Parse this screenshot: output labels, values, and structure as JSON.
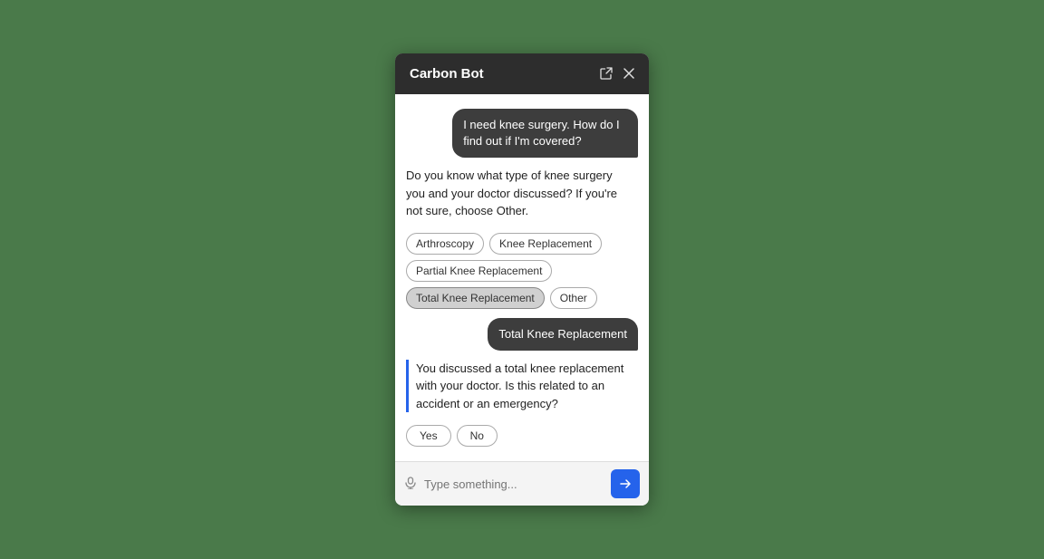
{
  "header": {
    "title": "Carbon Bot",
    "external_link_icon": "⬡",
    "close_icon": "✕"
  },
  "messages": [
    {
      "type": "user",
      "text": "I need knee surgery. How do I find out if I'm covered?"
    },
    {
      "type": "bot",
      "text": "Do you know what type of knee surgery you and your doctor discussed? If you're not sure, choose Other."
    },
    {
      "type": "chips",
      "options": [
        "Arthroscopy",
        "Knee Replacement",
        "Partial Knee Replacement",
        "Total Knee Replacement",
        "Other"
      ],
      "selected": "Total Knee Replacement"
    },
    {
      "type": "user",
      "text": "Total Knee Replacement"
    },
    {
      "type": "bot-accented",
      "text": "You discussed a total knee replacement with your doctor. Is this related to an accident or an emergency?"
    },
    {
      "type": "yn-chips",
      "options": [
        "Yes",
        "No"
      ]
    }
  ],
  "input": {
    "placeholder": "Type something...",
    "mic_label": "microphone",
    "send_label": "send"
  }
}
